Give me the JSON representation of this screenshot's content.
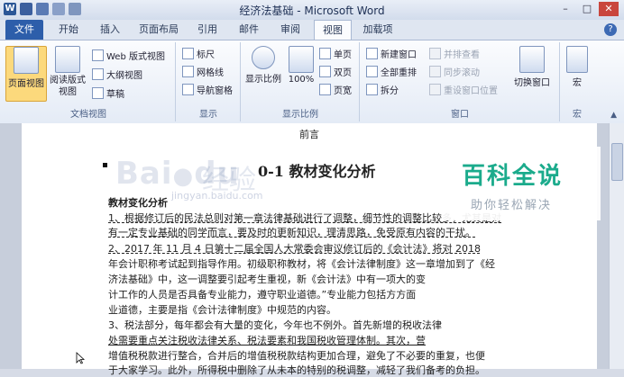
{
  "window": {
    "title": "经济法基础 - Microsoft Word",
    "app_icon": "W"
  },
  "tabs": [
    "文件",
    "开始",
    "插入",
    "页面布局",
    "引用",
    "邮件",
    "审阅",
    "视图",
    "加载项"
  ],
  "active_tab": "视图",
  "ribbon": {
    "doc_views": {
      "group": "文档视图",
      "page_view": "页面视图",
      "reading_view": "阅读版式视图",
      "web_view": "Web 版式视图",
      "outline": "大纲视图",
      "draft": "草稿"
    },
    "show": {
      "group": "显示",
      "ruler": "标尺",
      "gridlines": "网格线",
      "nav_pane": "导航窗格"
    },
    "zoom": {
      "group": "显示比例",
      "zoom": "显示比例",
      "hundred": "100%",
      "one_page": "单页",
      "two_pages": "双页",
      "page_width": "页宽"
    },
    "window": {
      "group": "窗口",
      "new_window": "新建窗口",
      "arrange_all": "全部重排",
      "split": "拆分",
      "side_by_side": "并排查看",
      "sync_scroll": "同步滚动",
      "reset_pos": "重设窗口位置",
      "switch_windows": "切换窗口"
    },
    "macros": {
      "group": "宏",
      "macro": "宏"
    }
  },
  "document": {
    "header": "前言",
    "heading": "0-1   教材变化分析",
    "watermark": {
      "baidu": "Bai",
      "du": "du",
      "jingyan": "经验",
      "url": "jingyan.baidu.com"
    },
    "lines": [
      "教材变化分析",
      "1、根据修订后的民法总则对第一章法律基础进行了调整，细节性的调整比较多，尤其是对",
      "有一定专业基础的同学而言，要及时的更新知识，理清思路，免受原有内容的干扰。",
      "2、2017 年 11 月 4 日第十二届全国人大常委会审议修订后的《会计法》将对 2018",
      "年会计职称考试起到指导作用。初级职称教材，将《会计法律制度》这一章增加到了《经",
      "济法基础》中，这一调整要引起考生重视，新《会计法》中有一项大的变",
      "计工作的人员是否具备专业能力，遵守职业道德。”专业能力包括方方面",
      "业道德，主要是指《会计法律制度》中规范的内容。",
      "3、税法部分，每年都会有大量的变化，今年也不例外。首先新增的税收法律",
      "处需要重点关注税收法律关系、税法要素和我国税收管理体制。其次，营",
      "增值税税款进行整合，合并后的增值税税款结构更加合理，避免了不必要的重复，也便",
      "于大家学习。此外，所得税中删除了从未本的特别的税调整，减轻了我们备考的负担。"
    ]
  },
  "overlay_watermark": {
    "main": "百科全说",
    "sub": "助你轻松解决"
  },
  "colors": {
    "file_tab": "#2d5eaa",
    "selected_button": "#fcd97c",
    "watermark_green": "#1bab8c"
  }
}
